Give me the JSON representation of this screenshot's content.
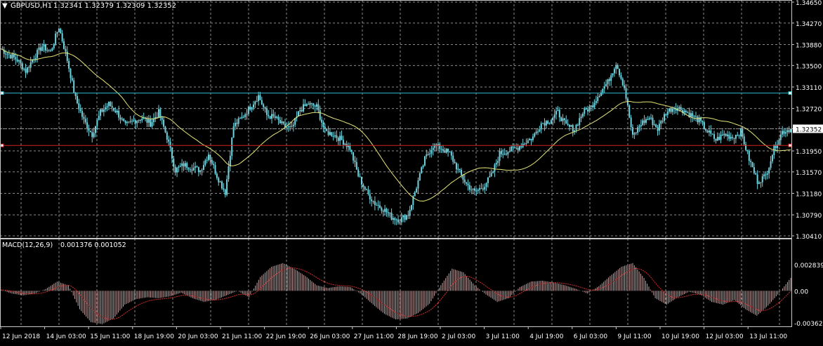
{
  "header": {
    "arrow": "▼",
    "symbol": "GBPUSD,H1",
    "ohlc": "1.32341 1.32379 1.32309 1.32352"
  },
  "macd_header": {
    "label": "MACD(12,26,9)",
    "values": "0.001376 0.001052"
  },
  "colors": {
    "background": "#000000",
    "grid": "#8a8a8a",
    "candle": "#6fd3de",
    "ma": "#e6e67a",
    "hline_cyan": "#2fb5c8",
    "hline_red": "#d42020",
    "macd_hist": "#c7a4a4",
    "macd_signal": "#d03030",
    "axis_text": "#ffffff",
    "price_tag_bg": "#ffffff",
    "price_tag_text": "#000000"
  },
  "chart_data": [
    {
      "type": "candlestick",
      "title": "GBPUSD,H1",
      "y_ticks": [
        "1.34650",
        "1.34270",
        "1.33880",
        "1.33500",
        "1.33110",
        "1.32720",
        "1.32352",
        "1.31950",
        "1.31570",
        "1.31180",
        "1.30790",
        "1.30410"
      ],
      "ylim": [
        1.3041,
        1.3465
      ],
      "current_price": "1.32352",
      "hlines": [
        {
          "name": "cyan-level",
          "value": 1.33
        },
        {
          "name": "red-level",
          "value": 1.3205
        }
      ],
      "close_series": [
        1.338,
        1.337,
        1.336,
        1.334,
        1.3365,
        1.3385,
        1.3375,
        1.342,
        1.336,
        1.329,
        1.325,
        1.3225,
        1.3265,
        1.328,
        1.3265,
        1.324,
        1.325,
        1.3255,
        1.3245,
        1.3265,
        1.322,
        1.316,
        1.317,
        1.3165,
        1.316,
        1.319,
        1.315,
        1.312,
        1.324,
        1.3255,
        1.3275,
        1.3295,
        1.326,
        1.3255,
        1.324,
        1.3235,
        1.327,
        1.328,
        1.3275,
        1.323,
        1.3225,
        1.3215,
        1.32,
        1.315,
        1.312,
        1.31,
        1.309,
        1.3075,
        1.307,
        1.308,
        1.313,
        1.318,
        1.3205,
        1.32,
        1.319,
        1.316,
        1.3135,
        1.312,
        1.313,
        1.315,
        1.319,
        1.3195,
        1.32,
        1.321,
        1.322,
        1.3245,
        1.325,
        1.3265,
        1.324,
        1.3235,
        1.3265,
        1.3275,
        1.33,
        1.332,
        1.3355,
        1.331,
        1.322,
        1.3245,
        1.3255,
        1.3235,
        1.3265,
        1.3275,
        1.327,
        1.326,
        1.325,
        1.323,
        1.3215,
        1.3225,
        1.322,
        1.323,
        1.318,
        1.314,
        1.315,
        1.32,
        1.323,
        1.3235
      ]
    },
    {
      "type": "histogram",
      "title": "MACD(12,26,9)",
      "y_ticks": [
        "0.002839",
        "0.00",
        "-0.003621"
      ],
      "ylim": [
        -0.003621,
        0.002839
      ],
      "hist_series": [
        0.0001,
        -0.0003,
        -0.0005,
        -0.0003,
        0.0002,
        0.001,
        0.0006,
        -0.002,
        -0.0034,
        -0.0036,
        -0.003,
        -0.0015,
        -0.0009,
        -0.0007,
        -0.0008,
        -0.0006,
        -0.0002,
        -0.0008,
        -0.0012,
        -0.001,
        -0.0005,
        0.0,
        -0.0007,
        0.0015,
        0.0026,
        0.003,
        0.0024,
        0.0016,
        0.0006,
        0.0003,
        0.0005,
        0.0004,
        -0.0004,
        -0.0015,
        -0.0025,
        -0.0031,
        -0.003,
        -0.0024,
        -0.0014,
        0.0006,
        0.0024,
        0.002,
        0.0006,
        -0.0004,
        -0.0012,
        -0.0008,
        0.0004,
        0.001,
        0.0011,
        0.0009,
        0.0006,
        0.0002,
        -0.0003,
        0.0005,
        0.0016,
        0.0026,
        0.003,
        0.0014,
        -0.0008,
        -0.0015,
        -0.0007,
        -0.0001,
        -0.0004,
        -0.0012,
        -0.0015,
        -0.001,
        -0.002,
        -0.0027,
        -0.0016,
        -0.0002,
        0.0014
      ]
    }
  ],
  "x_axis": {
    "labels": [
      "12 Jun 2018",
      "14 Jun 03:00",
      "15 Jun 11:00",
      "18 Jun 19:00",
      "20 Jun 03:00",
      "21 Jun 11:00",
      "22 Jun 19:00",
      "26 Jun 03:00",
      "27 Jun 11:00",
      "28 Jun 19:00",
      "2 Jul 03:00",
      "3 Jul 11:00",
      "4 Jul 19:00",
      "6 Jul 03:00",
      "9 Jul 11:00",
      "10 Jul 19:00",
      "12 Jul 03:00",
      "13 Jul 11:00"
    ]
  }
}
